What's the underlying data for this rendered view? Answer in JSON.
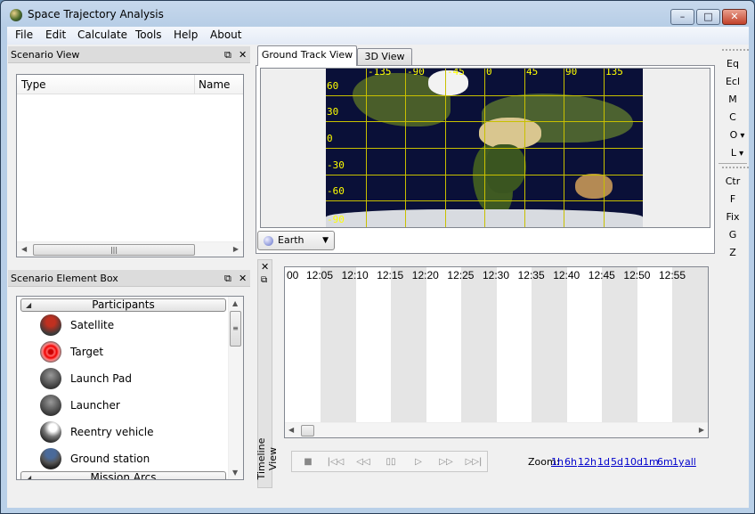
{
  "window": {
    "title": "Space Trajectory Analysis",
    "buttons": {
      "minimize": "–",
      "maximize": "□",
      "close": "✕"
    }
  },
  "menu": [
    "File",
    "Edit",
    "Calculate",
    "Tools",
    "Help",
    "About"
  ],
  "scenario_view": {
    "title": "Scenario View",
    "float_icon": "⧉",
    "close_icon": "✕",
    "columns": [
      "Type",
      "Name"
    ],
    "rows": [],
    "hscroll_grip": "|||"
  },
  "element_box": {
    "title": "Scenario Element Box",
    "float_icon": "⧉",
    "close_icon": "✕",
    "groups": [
      {
        "label": "Participants",
        "items": [
          {
            "label": "Satellite",
            "icon": "satellite-icon"
          },
          {
            "label": "Target",
            "icon": "target-icon"
          },
          {
            "label": "Launch Pad",
            "icon": "launch-pad-icon"
          },
          {
            "label": "Launcher",
            "icon": "launcher-icon"
          },
          {
            "label": "Reentry vehicle",
            "icon": "reentry-vehicle-icon"
          },
          {
            "label": "Ground station",
            "icon": "ground-station-icon"
          }
        ]
      },
      {
        "label": "Mission Arcs",
        "items": []
      }
    ]
  },
  "tabs": [
    {
      "label": "Ground Track View",
      "active": true
    },
    {
      "label": "3D View",
      "active": false
    }
  ],
  "map": {
    "lon_labels": [
      "-135",
      "-90",
      "-45",
      "0",
      "45",
      "90",
      "135"
    ],
    "lat_labels": [
      "60",
      "30",
      "0",
      "-30",
      "-60",
      "-90"
    ],
    "body_selector": "Earth"
  },
  "right_toolbar": {
    "group1": [
      "Eq",
      "Ecl",
      "M",
      "C",
      "O",
      "L"
    ],
    "dropdown_items": [
      "O",
      "L"
    ],
    "group2": [
      "Ctr",
      "F",
      "Fix",
      "G",
      "Z"
    ]
  },
  "timeline": {
    "title": "Timeline View",
    "close_icon": "✕",
    "float_icon": "⧉",
    "ticks": [
      "00",
      "12:05",
      "12:10",
      "12:15",
      "12:20",
      "12:25",
      "12:30",
      "12:35",
      "12:40",
      "12:45",
      "12:50",
      "12:55"
    ],
    "playback": [
      "■",
      "|◁◁",
      "◁◁",
      "▯▯",
      "▷",
      "▷▷",
      "▷▷|"
    ],
    "zoom_label": "Zoom:",
    "zoom_levels": [
      "1h",
      "6h",
      "12h",
      "1d",
      "5d",
      "10d",
      "1m",
      "6m",
      "1y",
      "all"
    ]
  }
}
